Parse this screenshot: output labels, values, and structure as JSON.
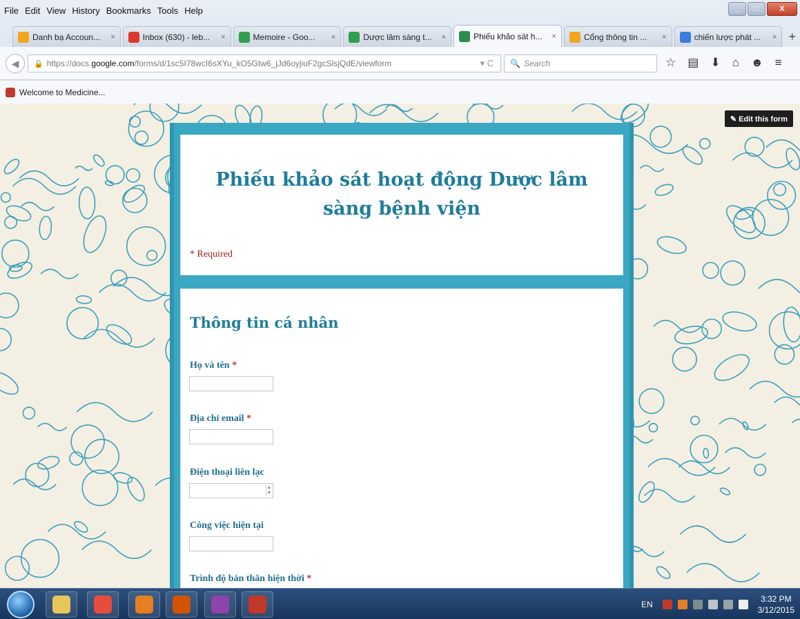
{
  "menubar": {
    "items": [
      "File",
      "Edit",
      "View",
      "History",
      "Bookmarks",
      "Tools",
      "Help"
    ]
  },
  "window_controls": {
    "minimize": "_",
    "maximize": "□",
    "close": "X"
  },
  "tabs": [
    {
      "title": "Danh bạ Accoun...",
      "icon": "google-sites-icon",
      "color": "#f2a51f",
      "active": false
    },
    {
      "title": "Inbox (630) - leb...",
      "icon": "gmail-icon",
      "color": "#db3a2e",
      "active": false
    },
    {
      "title": "Memoire - Goo...",
      "icon": "google-drive-icon",
      "color": "#2f9e4d",
      "active": false
    },
    {
      "title": "Dược lâm sàng t...",
      "icon": "google-drive-icon",
      "color": "#2f9e4d",
      "active": false
    },
    {
      "title": "Phiếu khảo sát h...",
      "icon": "google-forms-icon",
      "color": "#2e8b4f",
      "active": true
    },
    {
      "title": "Cổng thông tin ...",
      "icon": "google-sites-icon",
      "color": "#f2a51f",
      "active": false
    },
    {
      "title": "chiến lược phát ...",
      "icon": "google-search-icon",
      "color": "#3d7be0",
      "active": false
    }
  ],
  "tab_close_label": "×",
  "new_tab_label": "+",
  "navbar": {
    "url_prefix": "https://docs.",
    "url_domain": "google.com",
    "url_path": "/forms/d/1sc5I78wcI6sXYu_kO5Gtw6_jJd6oyjiuF2gcSlsjQdE/viewform",
    "search_placeholder": "Search",
    "reload_label": "C"
  },
  "bookmarks": [
    {
      "label": "Welcome to Medicine...",
      "icon": "medicine-icon"
    }
  ],
  "form": {
    "edit_button": "✎ Edit this form",
    "title": "Phiếu khảo sát hoạt động Dược lâm sàng bệnh viện",
    "required_note": "* Required",
    "section_title": "Thông tin cá nhân",
    "questions": [
      {
        "label": "Họ và tên",
        "required": true,
        "value": ""
      },
      {
        "label": "Địa chỉ email",
        "required": true,
        "value": ""
      },
      {
        "label": "Điện thoại liên lạc",
        "required": false,
        "value": ""
      },
      {
        "label": "Công việc hiện tại",
        "required": false,
        "value": ""
      },
      {
        "label": "Trình độ bản thân hiện thời",
        "required": true
      }
    ],
    "required_marker": "*"
  },
  "taskbar": {
    "apps": [
      "explorer-icon",
      "chrome-icon",
      "firefox-icon",
      "office-icon",
      "winrar-icon",
      "acrobat-icon"
    ],
    "language": "EN",
    "time": "3:32 PM",
    "date": "3/12/2015"
  },
  "colors": {
    "form_accent": "#1f7d9b",
    "frame": "#3aa7c3",
    "pattern_line": "#3d9fbb",
    "required": "#a01a1a"
  }
}
